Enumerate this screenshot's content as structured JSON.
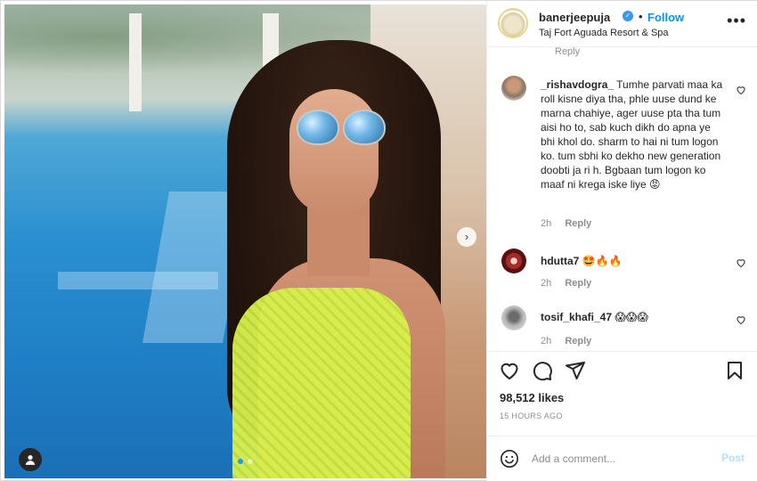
{
  "header": {
    "username": "banerjeepuja",
    "verified": true,
    "bullet": "•",
    "follow_label": "Follow",
    "location": "Taj Fort Aguada Resort & Spa",
    "more_label": "•••"
  },
  "comments": {
    "top_partial_reply": "Reply",
    "items": [
      {
        "username": "_rishavdogra_",
        "text": "Tumhe parvati maa ka roll kisne diya tha, phle uuse dund ke marna chahiye, ager uuse pta tha tum aisi ho to, sab kuch dikh do apna ye bhi khol do. sharm to hai ni tum logon ko. tum sbhi ko dekho new generation doobti ja ri h. Bgbaan tum logon ko maaf ni krega iske liye 😡",
        "time": "2h",
        "reply_label": "Reply"
      },
      {
        "username": "hdutta7",
        "text": "🤩🔥🔥",
        "time": "2h",
        "reply_label": "Reply"
      },
      {
        "username": "tosif_khafi_47",
        "text": "😱😱😱",
        "time": "2h",
        "reply_label": "Reply"
      }
    ]
  },
  "post": {
    "likes": "98,512 likes",
    "timestamp": "15 HOURS AGO"
  },
  "add_comment": {
    "placeholder": "Add a comment...",
    "post_label": "Post"
  },
  "carousel": {
    "next_arrow": "›",
    "slide_count": 2,
    "active_slide": 1
  },
  "colors": {
    "accent": "#0095f6",
    "verified": "#3897f0",
    "muted": "#8e8e8e"
  }
}
